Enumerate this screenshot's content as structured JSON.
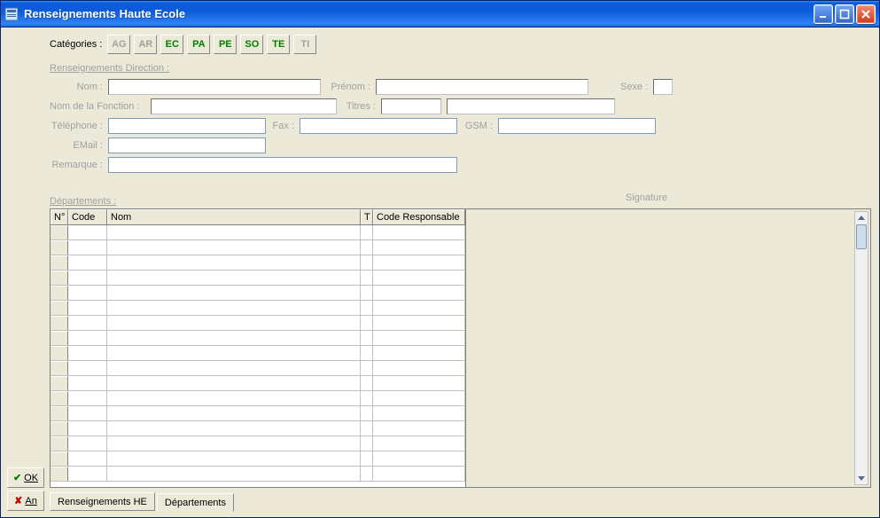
{
  "window": {
    "title": "Renseignements Haute Ecole"
  },
  "side": {
    "ok": "OK",
    "cancel": "An"
  },
  "categories": {
    "label": "Catégories :",
    "buttons": [
      {
        "code": "AG",
        "enabled": false
      },
      {
        "code": "AR",
        "enabled": false
      },
      {
        "code": "EC",
        "enabled": true
      },
      {
        "code": "PA",
        "enabled": true
      },
      {
        "code": "PE",
        "enabled": true
      },
      {
        "code": "SO",
        "enabled": true
      },
      {
        "code": "TE",
        "enabled": true
      },
      {
        "code": "TI",
        "enabled": false
      }
    ]
  },
  "direction": {
    "group_title": "Renseignements Direction :",
    "nom_label": "Nom :",
    "nom": "",
    "prenom_label": "Prénom :",
    "prenom": "",
    "sexe_label": "Sexe :",
    "sexe": "",
    "fonction_label": "Nom de la Fonction :",
    "fonction": "",
    "titres_label": "Titres :",
    "titre1": "",
    "titre2": "",
    "tel_label": "Téléphone :",
    "tel": "",
    "fax_label": "Fax :",
    "fax": "",
    "gsm_label": "GSM :",
    "gsm": "",
    "email_label": "EMail :",
    "email": "",
    "remarque_label": "Remarque :",
    "remarque": "",
    "signature_label": "Signature"
  },
  "departements": {
    "section_title": "Départements :",
    "columns": {
      "num": "N°",
      "code": "Code",
      "nom": "Nom",
      "t": "T",
      "resp": "Code Responsable"
    },
    "rows": [
      {
        "num": "",
        "code": "",
        "nom": "",
        "t": "",
        "resp": ""
      },
      {
        "num": "",
        "code": "",
        "nom": "",
        "t": "",
        "resp": ""
      },
      {
        "num": "",
        "code": "",
        "nom": "",
        "t": "",
        "resp": ""
      },
      {
        "num": "",
        "code": "",
        "nom": "",
        "t": "",
        "resp": ""
      },
      {
        "num": "",
        "code": "",
        "nom": "",
        "t": "",
        "resp": ""
      },
      {
        "num": "",
        "code": "",
        "nom": "",
        "t": "",
        "resp": ""
      },
      {
        "num": "",
        "code": "",
        "nom": "",
        "t": "",
        "resp": ""
      },
      {
        "num": "",
        "code": "",
        "nom": "",
        "t": "",
        "resp": ""
      },
      {
        "num": "",
        "code": "",
        "nom": "",
        "t": "",
        "resp": ""
      },
      {
        "num": "",
        "code": "",
        "nom": "",
        "t": "",
        "resp": ""
      },
      {
        "num": "",
        "code": "",
        "nom": "",
        "t": "",
        "resp": ""
      },
      {
        "num": "",
        "code": "",
        "nom": "",
        "t": "",
        "resp": ""
      },
      {
        "num": "",
        "code": "",
        "nom": "",
        "t": "",
        "resp": ""
      },
      {
        "num": "",
        "code": "",
        "nom": "",
        "t": "",
        "resp": ""
      },
      {
        "num": "",
        "code": "",
        "nom": "",
        "t": "",
        "resp": ""
      },
      {
        "num": "",
        "code": "",
        "nom": "",
        "t": "",
        "resp": ""
      },
      {
        "num": "",
        "code": "",
        "nom": "",
        "t": "",
        "resp": ""
      }
    ]
  },
  "tabs": {
    "tab1": "Renseignements HE",
    "tab2": "Départements"
  }
}
